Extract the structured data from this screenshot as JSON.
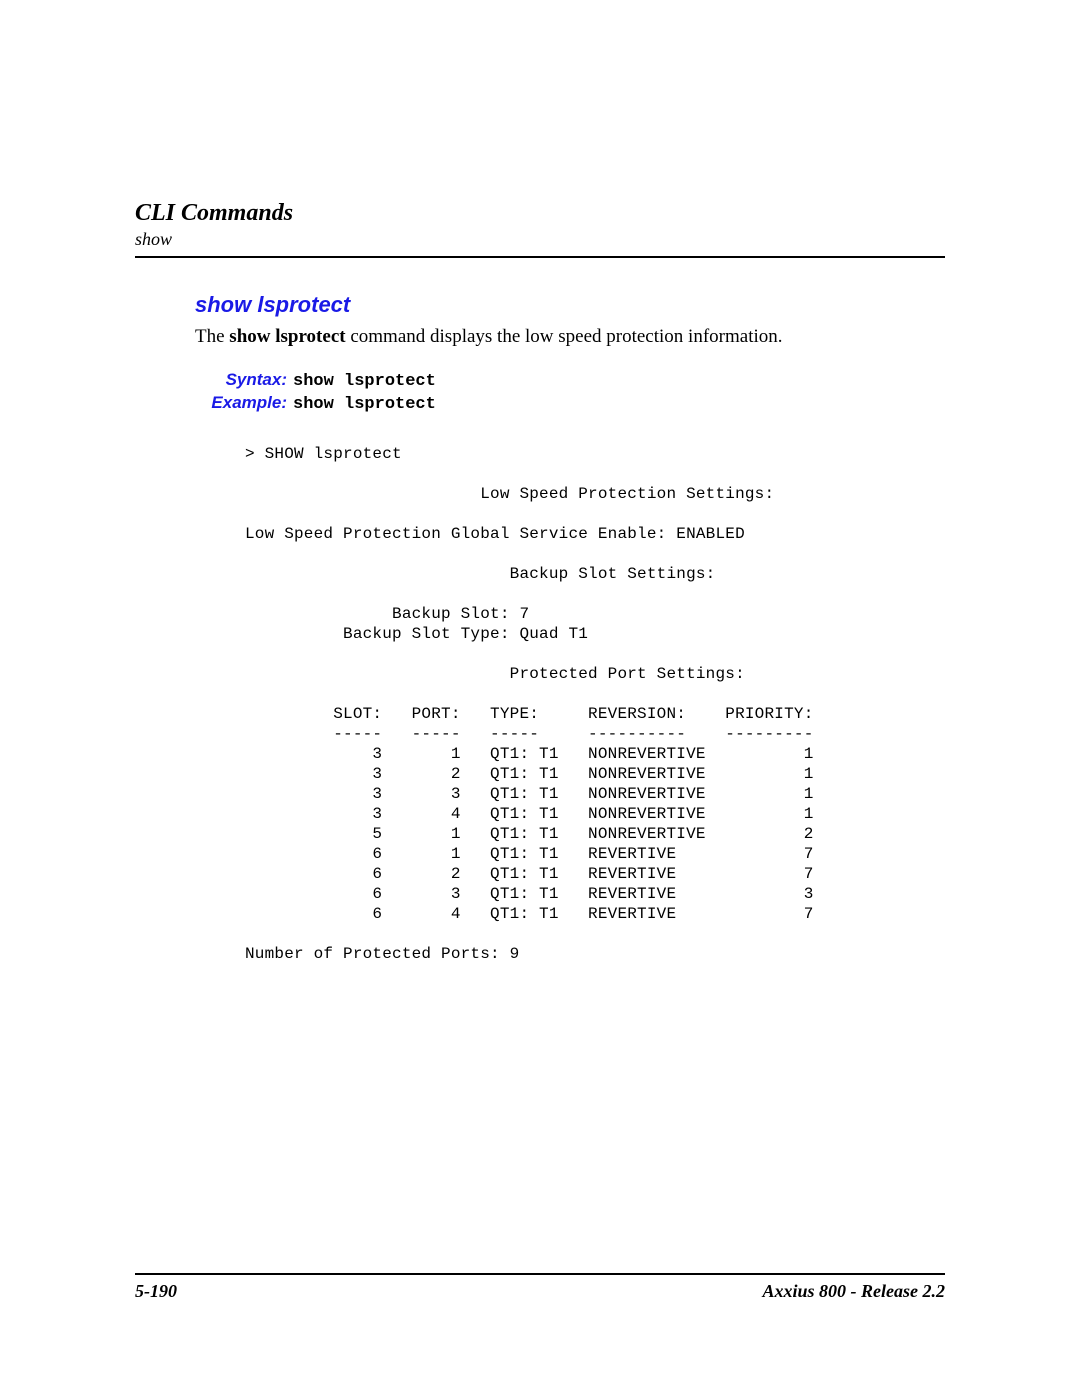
{
  "header": {
    "title": "CLI Commands",
    "sub": "show"
  },
  "command": {
    "title": "show lsprotect",
    "desc_prefix": "The ",
    "desc_bold": "show lsprotect",
    "desc_suffix": " command displays the low speed protection information.",
    "syntax_label": "Syntax:",
    "syntax_value": "show lsprotect",
    "example_label": "Example:",
    "example_value": "show lsprotect"
  },
  "cli": {
    "prompt_line": "> SHOW lsprotect",
    "heading_settings": "Low Speed Protection Settings:",
    "global_enable_line": "Low Speed Protection Global Service Enable: ENABLED",
    "backup_settings_heading": "Backup Slot Settings:",
    "backup_slot_line": "Backup Slot: 7",
    "backup_slot_type_line": "Backup Slot Type: Quad T1",
    "protected_port_heading": "Protected Port Settings:",
    "table_header": {
      "slot": "SLOT:",
      "port": "PORT:",
      "type": "TYPE:",
      "reversion": "REVERSION:",
      "priority": "PRIORITY:"
    },
    "rows": [
      {
        "slot": "3",
        "port": "1",
        "type": "QT1: T1",
        "reversion": "NONREVERTIVE",
        "priority": "1"
      },
      {
        "slot": "3",
        "port": "2",
        "type": "QT1: T1",
        "reversion": "NONREVERTIVE",
        "priority": "1"
      },
      {
        "slot": "3",
        "port": "3",
        "type": "QT1: T1",
        "reversion": "NONREVERTIVE",
        "priority": "1"
      },
      {
        "slot": "3",
        "port": "4",
        "type": "QT1: T1",
        "reversion": "NONREVERTIVE",
        "priority": "1"
      },
      {
        "slot": "5",
        "port": "1",
        "type": "QT1: T1",
        "reversion": "NONREVERTIVE",
        "priority": "2"
      },
      {
        "slot": "6",
        "port": "1",
        "type": "QT1: T1",
        "reversion": "REVERTIVE",
        "priority": "7"
      },
      {
        "slot": "6",
        "port": "2",
        "type": "QT1: T1",
        "reversion": "REVERTIVE",
        "priority": "7"
      },
      {
        "slot": "6",
        "port": "3",
        "type": "QT1: T1",
        "reversion": "REVERTIVE",
        "priority": "3"
      },
      {
        "slot": "6",
        "port": "4",
        "type": "QT1: T1",
        "reversion": "REVERTIVE",
        "priority": "7"
      }
    ],
    "num_ports_line": "Number of Protected Ports: 9"
  },
  "footer": {
    "left": "5-190",
    "right": "Axxius 800 - Release 2.2"
  }
}
